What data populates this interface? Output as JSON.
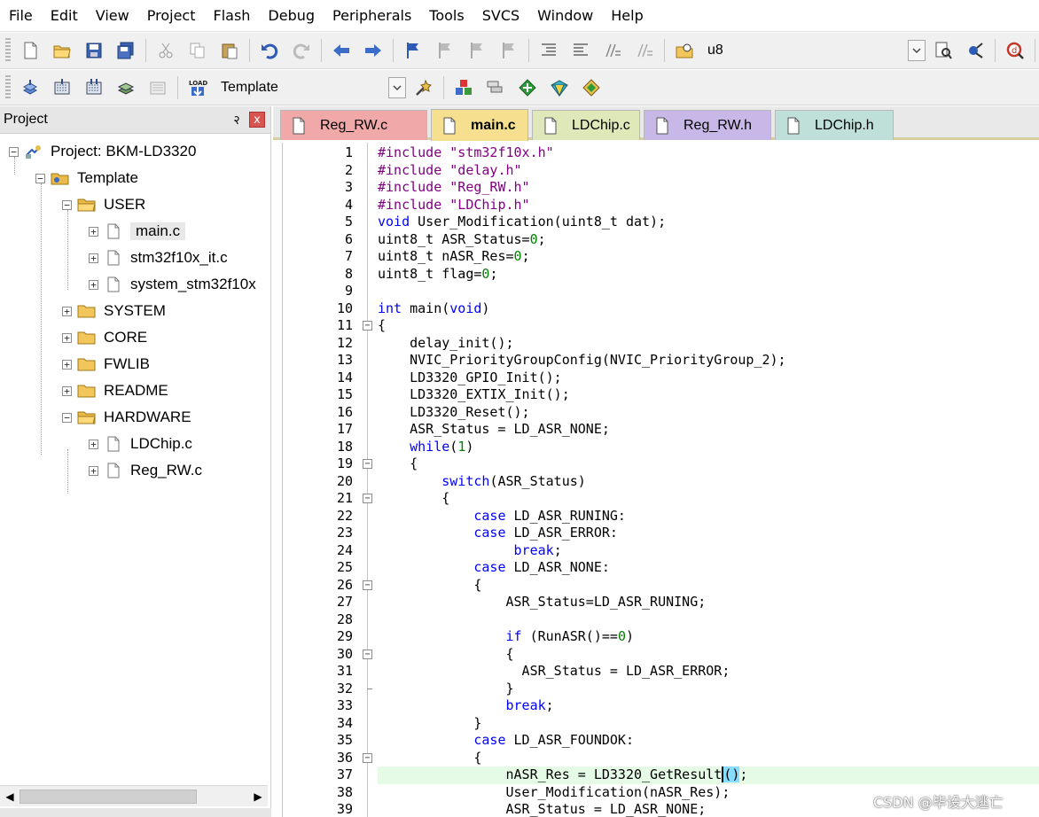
{
  "menu": [
    "File",
    "Edit",
    "View",
    "Project",
    "Flash",
    "Debug",
    "Peripherals",
    "Tools",
    "SVCS",
    "Window",
    "Help"
  ],
  "toolbar1": {
    "target_text": "u8"
  },
  "toolbar2": {
    "target_select": "Template"
  },
  "project_panel": {
    "title": "Project",
    "pin": "२",
    "close": "x",
    "tree": {
      "root": "Project: BKM-LD3320",
      "target": "Template",
      "groups": [
        {
          "name": "USER",
          "files": [
            "main.c",
            "stm32f10x_it.c",
            "system_stm32f10x"
          ]
        },
        {
          "name": "SYSTEM"
        },
        {
          "name": "CORE"
        },
        {
          "name": "FWLIB"
        },
        {
          "name": "README"
        },
        {
          "name": "HARDWARE",
          "files": [
            "LDChip.c",
            "Reg_RW.c"
          ]
        }
      ]
    }
  },
  "tabs": [
    {
      "label": "Reg_RW.c",
      "color": "#f1a8a8"
    },
    {
      "label": "main.c",
      "color": "#f6e08f",
      "active": true
    },
    {
      "label": "LDChip.c",
      "color": "#dfe8b8"
    },
    {
      "label": "Reg_RW.h",
      "color": "#c8b8e8"
    },
    {
      "label": "LDChip.h",
      "color": "#bfe0d8"
    }
  ],
  "code": {
    "lines": [
      "1",
      "2",
      "3",
      "4",
      "5",
      "6",
      "7",
      "8",
      "9",
      "10",
      "11",
      "12",
      "13",
      "14",
      "15",
      "16",
      "17",
      "18",
      "19",
      "20",
      "21",
      "22",
      "23",
      "24",
      "25",
      "26",
      "27",
      "28",
      "29",
      "30",
      "31",
      "32",
      "33",
      "34",
      "35",
      "36",
      "37",
      "38",
      "39"
    ],
    "text": [
      "#include \"stm32f10x.h\"",
      "#include \"delay.h\"",
      "#include \"Reg_RW.h\"",
      "#include \"LDChip.h\"",
      "void User_Modification(uint8_t dat);",
      "uint8_t ASR_Status=0;",
      "uint8_t nASR_Res=0;",
      "uint8_t flag=0;",
      "",
      "int main(void)",
      "{",
      "    delay_init();",
      "    NVIC_PriorityGroupConfig(NVIC_PriorityGroup_2);",
      "    LD3320_GPIO_Init();",
      "    LD3320_EXTIX_Init();",
      "    LD3320_Reset();",
      "    ASR_Status = LD_ASR_NONE;",
      "    while(1)",
      "    {",
      "        switch(ASR_Status)",
      "        {",
      "            case LD_ASR_RUNING:",
      "            case LD_ASR_ERROR:",
      "                 break;",
      "            case LD_ASR_NONE:",
      "            {",
      "                ASR_Status=LD_ASR_RUNING;",
      "",
      "                if (RunASR()==0)",
      "                {",
      "                  ASR_Status = LD_ASR_ERROR;",
      "                }",
      "                break;",
      "            }",
      "            case LD_ASR_FOUNDOK:",
      "            {",
      "                nASR_Res = LD3320_GetResult();",
      "                User_Modification(nASR_Res);",
      "                ASR_Status = LD_ASR_NONE;"
    ]
  },
  "watermark": "CSDN @毕设大逃亡"
}
